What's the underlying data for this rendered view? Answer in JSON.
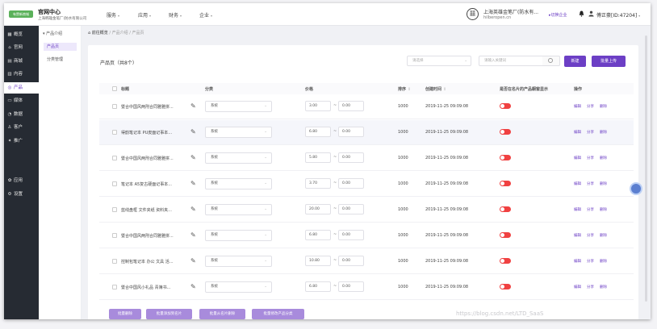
{
  "topbar": {
    "logo_text": "有赞新商城",
    "brand_title": "官网中心",
    "brand_sub": "上海韩雄金笔厂(防水有限公司",
    "nav": [
      {
        "label": "服务"
      },
      {
        "label": "应用"
      },
      {
        "label": "财务"
      },
      {
        "label": "企业"
      }
    ],
    "company_name": "上海英雄金笔厂(防水有...",
    "company_domain": "hilberopen.cn",
    "switch_label": "▸切换企业",
    "user_name": "傅正豪[ID:47204]"
  },
  "sidebar": {
    "items": [
      {
        "icon": "▦",
        "label": "概览",
        "icon_name": "overview-icon"
      },
      {
        "icon": "⌂",
        "label": "官网",
        "icon_name": "website-icon"
      },
      {
        "icon": "▤",
        "label": "商城",
        "icon_name": "mall-icon"
      },
      {
        "icon": "▥",
        "label": "内容",
        "icon_name": "content-icon"
      },
      {
        "icon": "◎",
        "label": "产品",
        "icon_name": "product-icon"
      },
      {
        "icon": "▭",
        "label": "媒体",
        "icon_name": "media-icon"
      },
      {
        "icon": "◔",
        "label": "数据",
        "icon_name": "data-icon"
      },
      {
        "icon": "♙",
        "label": "客户",
        "icon_name": "customer-icon"
      },
      {
        "icon": "✦",
        "label": "推广",
        "icon_name": "promo-icon"
      },
      {
        "icon": "✿",
        "label": "应用",
        "icon_name": "apps-icon"
      },
      {
        "icon": "⚙",
        "label": "设置",
        "icon_name": "settings-icon"
      }
    ]
  },
  "submenu": {
    "group": "▾ 产品介绍",
    "items": [
      {
        "label": "产品页"
      },
      {
        "label": "分类管理"
      }
    ]
  },
  "breadcrumb": {
    "home": "⌂ 前往概览",
    "crumbs": "/ 产品介绍 / 产品页"
  },
  "card": {
    "title": "产品页（共8个）",
    "category_placeholder": "请选择",
    "search_placeholder": "请输入关键词",
    "new_label": "新建",
    "bulk_upload_label": "批量上传"
  },
  "table": {
    "headers": {
      "title": "标题",
      "category": "分类",
      "price": "价格",
      "sort": "排序",
      "created": "创建时间",
      "show_in_card": "是否在名片的产品橱窗显示",
      "actions": "操作"
    },
    "action_labels": {
      "edit": "编辑",
      "share": "分享",
      "delete": "删除"
    },
    "rows": [
      {
        "title": "暨合中国风两刑合同雅雅拼...",
        "category": "系统",
        "price_min": "3.00",
        "price_max": "0.00",
        "sort": "1000",
        "created": "2019-11-25 09:09:08",
        "shown": false
      },
      {
        "title": "得韵笔记本 PU皮面记事本...",
        "category": "系统",
        "price_min": "6.80",
        "price_max": "0.00",
        "sort": "1000",
        "created": "2019-11-25 09:09:08",
        "shown": false
      },
      {
        "title": "暨合中国风两刑合同雅雅拼...",
        "category": "系统",
        "price_min": "5.80",
        "price_max": "0.00",
        "sort": "1000",
        "created": "2019-11-25 09:09:08",
        "shown": false
      },
      {
        "title": "笔记本 A5复古硬面记事本...",
        "category": "系统",
        "price_min": "3.70",
        "price_max": "0.00",
        "sort": "1000",
        "created": "2019-11-25 09:09:08",
        "shown": false
      },
      {
        "title": "蓝线盘框 文件夹纸 资料夹...",
        "category": "系统",
        "price_min": "20.00",
        "price_max": "0.00",
        "sort": "1000",
        "created": "2019-11-25 09:09:08",
        "shown": false
      },
      {
        "title": "暨合中国风两刑合同雅雅拼...",
        "category": "系统",
        "price_min": "6.80",
        "price_max": "0.00",
        "sort": "1000",
        "created": "2019-11-25 09:09:08",
        "shown": false
      },
      {
        "title": "控制包笔记本 办公 文具 活...",
        "category": "系统",
        "price_min": "10.80",
        "price_max": "0.00",
        "sort": "1000",
        "created": "2019-11-25 09:09:08",
        "shown": false
      },
      {
        "title": "暨合中国风小礼品 青簿书...",
        "category": "系统",
        "price_min": "6.80",
        "price_max": "0.00",
        "sort": "1000",
        "created": "2019-11-25 09:09:08",
        "shown": false
      }
    ]
  },
  "footer_buttons": [
    {
      "label": "批量删除"
    },
    {
      "label": "批量添加到名片"
    },
    {
      "label": "批量从名片删除"
    },
    {
      "label": "批量修改产品分类"
    }
  ],
  "watermark": "https://blog.csdn.net/LTD_SaaS",
  "colors": {
    "accent": "#6c3fc5",
    "sidebar": "#262b33",
    "toggle_off": "#f04141"
  }
}
